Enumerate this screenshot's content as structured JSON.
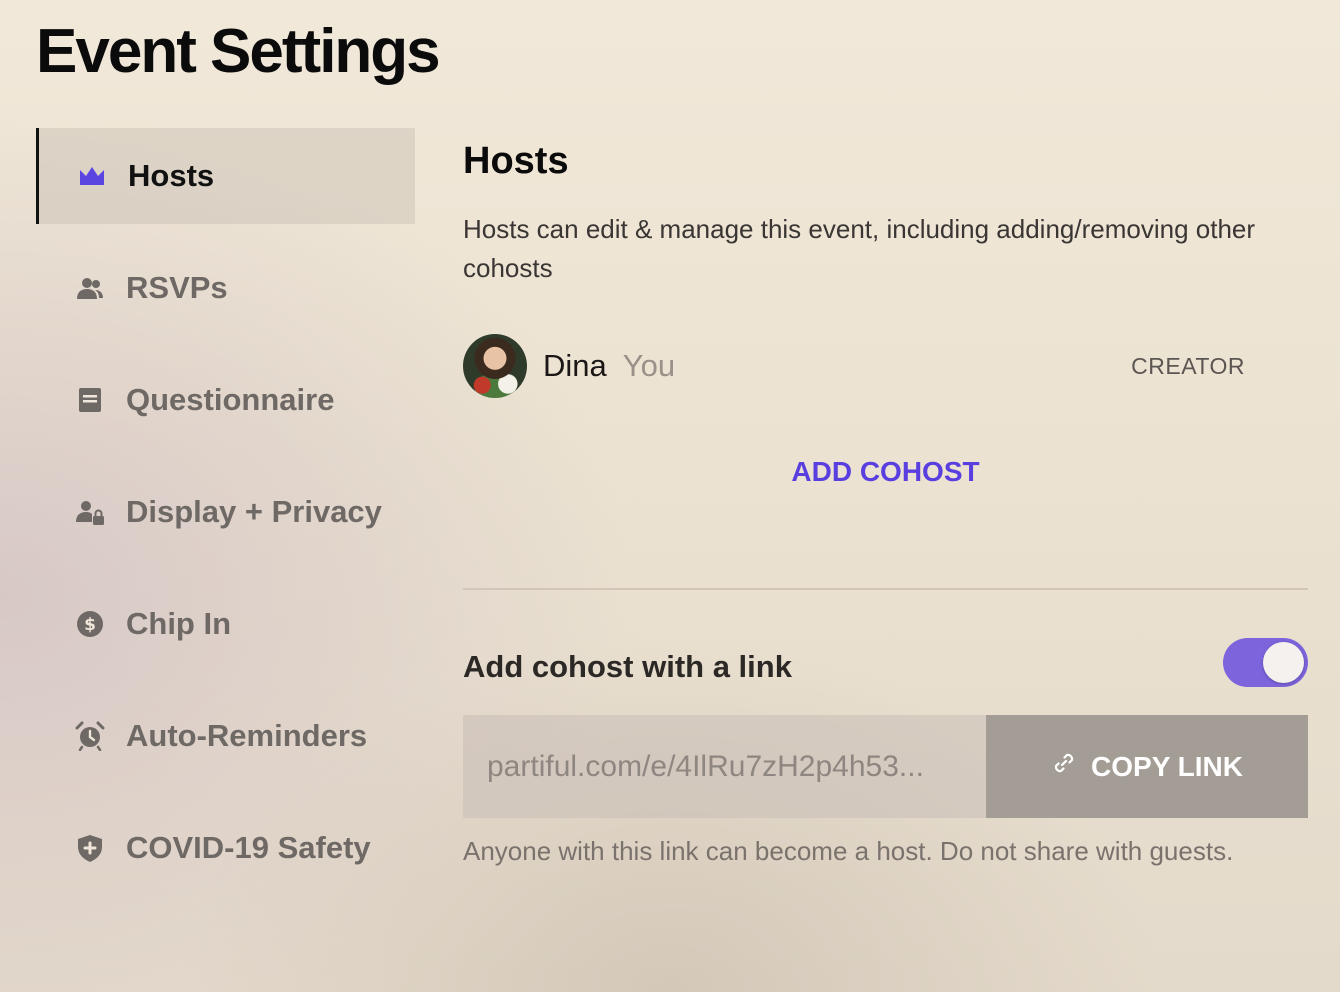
{
  "page": {
    "title": "Event Settings"
  },
  "sidebar": {
    "items": [
      {
        "label": "Hosts",
        "icon": "crown-icon",
        "active": true
      },
      {
        "label": "RSVPs",
        "icon": "people-icon"
      },
      {
        "label": "Questionnaire",
        "icon": "form-icon"
      },
      {
        "label": "Display + Privacy",
        "icon": "user-lock-icon"
      },
      {
        "label": "Chip In",
        "icon": "dollar-icon"
      },
      {
        "label": "Auto-Reminders",
        "icon": "alarm-clock-icon"
      },
      {
        "label": "COVID-19 Safety",
        "icon": "shield-plus-icon"
      }
    ]
  },
  "main": {
    "title": "Hosts",
    "description": "Hosts can edit & manage this event, including adding/removing other cohosts",
    "host": {
      "name": "Dina",
      "you_label": "You",
      "role": "CREATOR"
    },
    "add_cohost_label": "ADD COHOST",
    "link_section": {
      "title": "Add cohost with a link",
      "toggle_on": true,
      "link_value": "partiful.com/e/4IlRu7zH2p4h53...",
      "copy_label": "COPY LINK",
      "note": "Anyone with this link can become a host. Do not share with guests."
    }
  },
  "colors": {
    "accent": "#5a3fe0",
    "toggle": "#7d64dc",
    "active_icon": "#5b45e0",
    "inactive_icon": "#6f6966"
  }
}
